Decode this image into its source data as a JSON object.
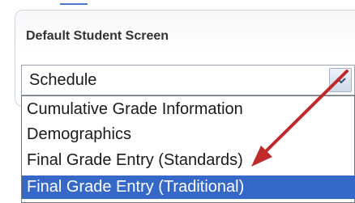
{
  "panel": {
    "label": "Default Student Screen",
    "select": {
      "value": "Schedule",
      "options": [
        "Cumulative Grade Information",
        "Demographics",
        "Final Grade Entry (Standards)",
        "Final Grade Entry (Traditional)"
      ],
      "highlighted_option": "Final Grade Entry (Traditional)"
    }
  },
  "annotation": {
    "arrow_color": "#c0282a"
  },
  "colors": {
    "highlight": "#3568c9",
    "label": "#333333"
  },
  "icons": {
    "dropdown": "chevron-down-icon",
    "pointer": "red-arrow"
  }
}
